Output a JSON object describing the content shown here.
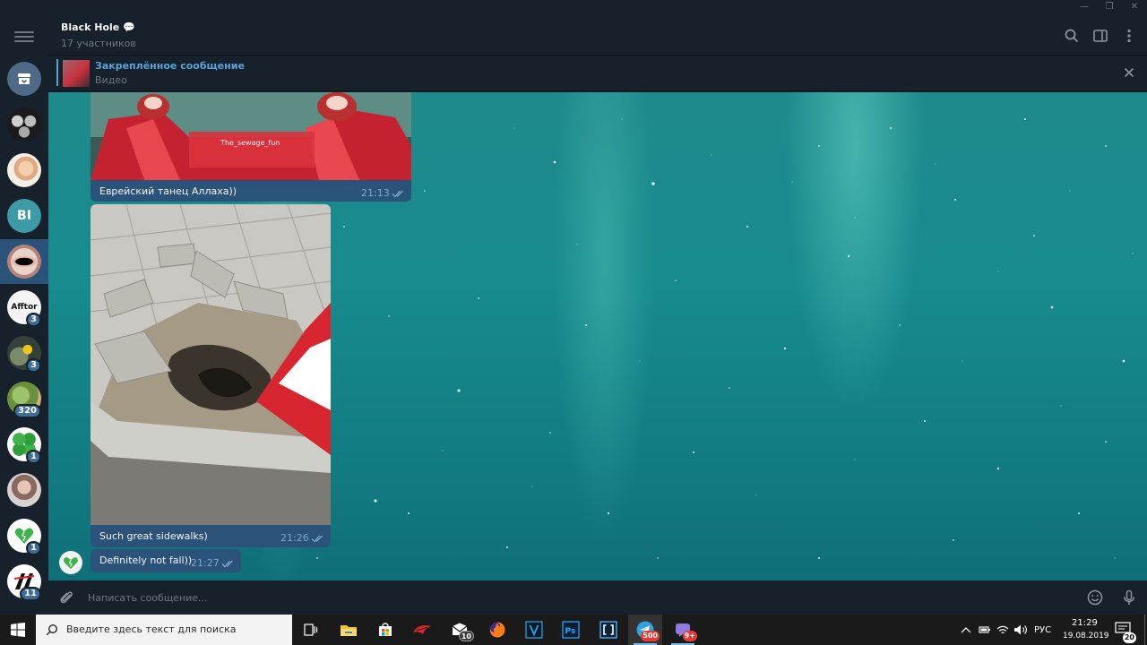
{
  "window": {
    "controls": {
      "minimize": "—",
      "restore": "❐",
      "close": "✕"
    }
  },
  "sidebar": {
    "items": [
      {
        "kind": "archive",
        "icon": "archive-icon",
        "badge": ""
      },
      {
        "kind": "avatar",
        "initials": "",
        "badge": ""
      },
      {
        "kind": "avatar",
        "initials": "",
        "badge": ""
      },
      {
        "kind": "avatar",
        "initials": "BI",
        "badge": ""
      },
      {
        "kind": "avatar",
        "initials": "",
        "badge": "",
        "active": true
      },
      {
        "kind": "avatar",
        "initials": "",
        "logo_text": "Afftor",
        "badge": "3"
      },
      {
        "kind": "avatar",
        "initials": "",
        "badge": "3"
      },
      {
        "kind": "avatar",
        "initials": "",
        "badge": "320"
      },
      {
        "kind": "avatar",
        "initials": "",
        "badge": "1"
      },
      {
        "kind": "avatar",
        "initials": "",
        "badge": ""
      },
      {
        "kind": "avatar",
        "initials": "",
        "badge": "1"
      },
      {
        "kind": "avatar",
        "initials": "",
        "badge": "11"
      }
    ]
  },
  "header": {
    "title": "Black Hole 💬",
    "subtitle": "17 участников",
    "icons": [
      "search-icon",
      "sidebar-toggle-icon",
      "more-vertical-icon"
    ]
  },
  "pinned": {
    "title": "Закреплённое сообщение",
    "subtitle": "Видео"
  },
  "messages": [
    {
      "kind": "video",
      "watermark": "The_sewage_fun",
      "text": "Еврейский танец Аллаха))",
      "time": "21:13",
      "status": "read"
    },
    {
      "kind": "photo",
      "text": "Such great sidewalks)",
      "time": "21:26",
      "status": "read"
    },
    {
      "kind": "text",
      "text": "Definitely not fall))",
      "time": "21:27",
      "status": "read"
    }
  ],
  "composer": {
    "placeholder": "Написать сообщение...",
    "icons": [
      "attach-icon",
      "emoji-icon",
      "microphone-icon"
    ]
  },
  "taskbar": {
    "search_placeholder": "Введите здесь текст для поиска",
    "apps": [
      {
        "name": "task-view-icon",
        "badge": ""
      },
      {
        "name": "file-explorer-icon",
        "badge": ""
      },
      {
        "name": "store-icon",
        "badge": ""
      },
      {
        "name": "game-app-icon",
        "badge": ""
      },
      {
        "name": "mail-icon",
        "badge": "10"
      },
      {
        "name": "firefox-icon",
        "badge": ""
      },
      {
        "name": "visual-studio-icon",
        "badge": ""
      },
      {
        "name": "photoshop-icon",
        "badge": ""
      },
      {
        "name": "bracket-app-icon",
        "badge": ""
      },
      {
        "name": "telegram-icon",
        "badge": "500"
      },
      {
        "name": "chat-app-icon",
        "badge": "9+"
      }
    ],
    "tray": {
      "language": "РУС",
      "time": "21:29",
      "date": "19.08.2019",
      "notifications": "20"
    }
  },
  "colors": {
    "app_bg": "#17212b",
    "bubble_out": "#2b5278",
    "accent": "#5aa2d8",
    "muted": "#6d7883"
  }
}
